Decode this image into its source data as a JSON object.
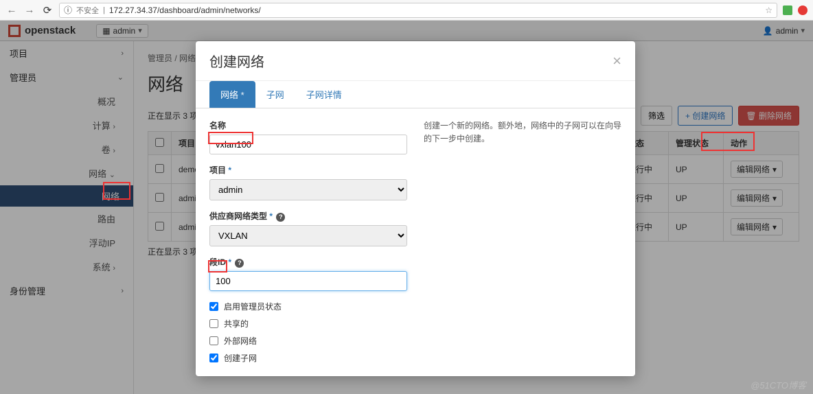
{
  "browser": {
    "insecure_label": "不安全",
    "url": "172.27.34.37/dashboard/admin/networks/"
  },
  "topbar": {
    "brand": "openstack",
    "project_group_label": "admin",
    "user_label": "admin"
  },
  "sidebar": {
    "items": [
      {
        "label": "项目",
        "expand": "›"
      },
      {
        "label": "管理员",
        "expand": "v",
        "children": [
          {
            "label": "概况"
          },
          {
            "label": "计算",
            "expand": "›"
          },
          {
            "label": "卷",
            "expand": "›"
          },
          {
            "label": "网络",
            "expand": "v",
            "children": [
              {
                "label": "网络",
                "active": true
              },
              {
                "label": "路由"
              },
              {
                "label": "浮动IP"
              }
            ]
          },
          {
            "label": "系统",
            "expand": "›"
          }
        ]
      },
      {
        "label": "身份管理",
        "expand": "›"
      }
    ]
  },
  "breadcrumb": {
    "a": "管理员",
    "b": "网络"
  },
  "page_title": "网络",
  "toolbar": {
    "filter": "筛选",
    "create": "创建网络",
    "delete": "删除网络"
  },
  "table": {
    "showing": "正在显示 3 项",
    "headers": {
      "project": "项目",
      "status": "状态",
      "admin_state": "管理状态",
      "actions": "动作"
    },
    "rows": [
      {
        "project": "demo",
        "status": "运行中",
        "admin_state": "UP",
        "action": "编辑网络"
      },
      {
        "project": "admin",
        "status": "运行中",
        "admin_state": "UP",
        "action": "编辑网络"
      },
      {
        "project": "admin",
        "status": "运行中",
        "admin_state": "UP",
        "action": "编辑网络"
      }
    ],
    "showing_bottom": "正在显示 3 项"
  },
  "modal": {
    "title": "创建网络",
    "tabs": {
      "network": "网络",
      "subnet": "子网",
      "subnet_detail": "子网详情"
    },
    "form": {
      "name_label": "名称",
      "name_value": "vxlan100",
      "project_label": "项目",
      "project_value": "admin",
      "provider_type_label": "供应商网络类型",
      "provider_type_value": "VXLAN",
      "segment_id_label": "段ID",
      "segment_id_value": "100",
      "enable_admin_label": "启用管理员状态",
      "enable_admin_checked": true,
      "shared_label": "共享的",
      "shared_checked": false,
      "external_label": "外部网络",
      "external_checked": false,
      "create_subnet_label": "创建子网",
      "create_subnet_checked": true
    },
    "help_text": "创建一个新的网络。额外地，网络中的子网可以在向导的下一步中创建。",
    "required_mark": "*"
  },
  "watermark": "@51CTO博客"
}
